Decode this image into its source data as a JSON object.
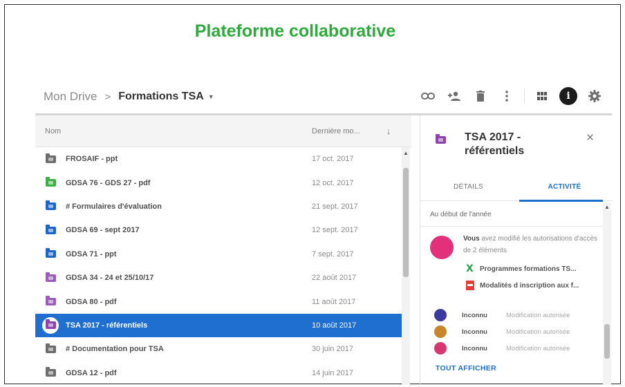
{
  "page_title": "Plateforme collaborative",
  "breadcrumb": {
    "root": "Mon Drive",
    "separator": ">",
    "current": "Formations TSA"
  },
  "toolbar": {
    "icons": [
      "link-icon",
      "add-person-icon",
      "trash-icon",
      "more-vert-icon",
      "grid-view-icon",
      "info-icon",
      "settings-icon"
    ],
    "info_label": "i"
  },
  "file_list": {
    "columns": {
      "name": "Nom",
      "date": "Dernière mo...",
      "sort": "↓"
    },
    "rows": [
      {
        "name": "FROSAIF - ppt",
        "date": "17 oct. 2017",
        "color": "#6d6d6d"
      },
      {
        "name": "GDSA 76 - GDS 27 - pdf",
        "date": "12 oct. 2017",
        "color": "#3cb043"
      },
      {
        "name": "# Formulaires d'évaluation",
        "date": "21 sept. 2017",
        "color": "#1e65c7"
      },
      {
        "name": "GDSA 69 - sept 2017",
        "date": "12 sept. 2017",
        "color": "#1e65c7"
      },
      {
        "name": "GDSA 71 - ppt",
        "date": "7 sept. 2017",
        "color": "#1e65c7"
      },
      {
        "name": "GDSA 34 - 24 et 25/10/17",
        "date": "22 août 2017",
        "color": "#9b5bb8"
      },
      {
        "name": "GDSA 80 - pdf",
        "date": "11 août 2017",
        "color": "#9b5bb8"
      },
      {
        "name": "TSA 2017 - référentiels",
        "date": "10 août 2017",
        "color": "#8e44ad",
        "selected": true
      },
      {
        "name": "# Documentation pour TSA",
        "date": "30 juin 2017",
        "color": "#6d6d6d"
      },
      {
        "name": "GDSA 12 - pdf",
        "date": "14 juin 2017",
        "color": "#6d6d6d"
      }
    ]
  },
  "details": {
    "title": "TSA 2017 - référentiels",
    "folder_color": "#8e44ad",
    "close": "×",
    "tabs": [
      {
        "label": "DÉTAILS",
        "active": false
      },
      {
        "label": "ACTIVITÉ",
        "active": true
      }
    ],
    "section": "Au début de l'année",
    "activity": {
      "avatar_color": "#e4307a",
      "actor": "Vous",
      "text": "avez modifié les autorisations d'accès de 2 éléments",
      "files": [
        {
          "name": "Programmes formations TS...",
          "icon": "sheets-icon"
        },
        {
          "name": "Modalités d inscription aux f...",
          "icon": "pdf-icon"
        }
      ]
    },
    "users": [
      {
        "name": "Inconnu",
        "permission": "Modification autorisée",
        "color": "#3b3aa0"
      },
      {
        "name": "Inconnu",
        "permission": "Modification autorisée",
        "color": "#c9852a"
      },
      {
        "name": "Inconnu",
        "permission": "Modification autorisée",
        "color": "#d93772"
      }
    ],
    "show_all": "TOUT AFFICHER"
  }
}
